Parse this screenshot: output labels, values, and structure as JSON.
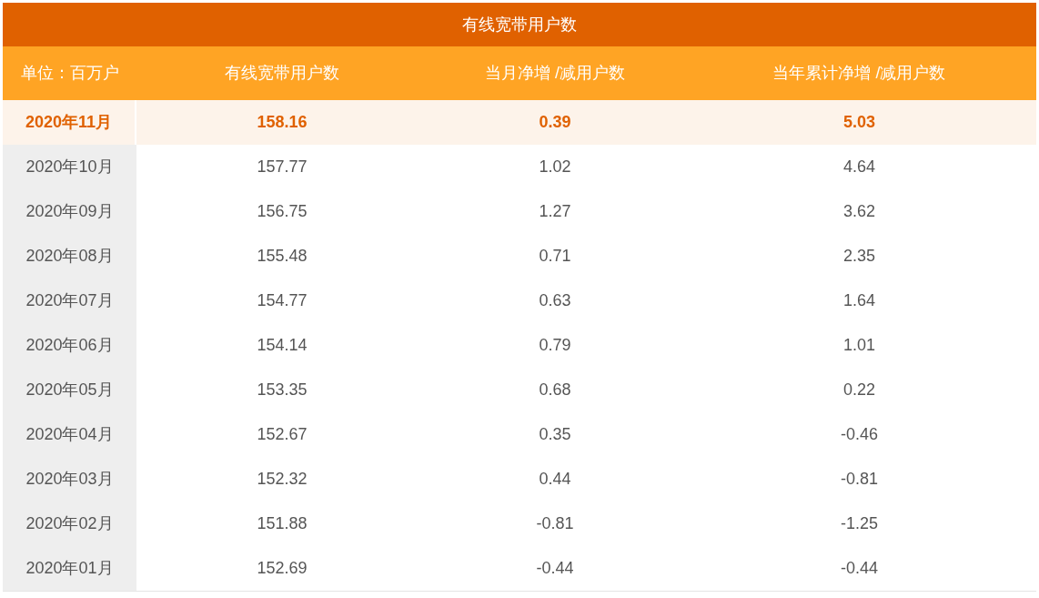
{
  "table": {
    "title": "有线宽带用户数",
    "columns": [
      "单位：百万户",
      "有线宽带用户数",
      "当月净增 /减用户数",
      "当年累计净增 /减用户数"
    ],
    "rows": [
      {
        "selected": true,
        "cells": [
          "2020年11月",
          "158.16",
          "0.39",
          "5.03"
        ]
      },
      {
        "selected": false,
        "cells": [
          "2020年10月",
          "157.77",
          "1.02",
          "4.64"
        ]
      },
      {
        "selected": false,
        "cells": [
          "2020年09月",
          "156.75",
          "1.27",
          "3.62"
        ]
      },
      {
        "selected": false,
        "cells": [
          "2020年08月",
          "155.48",
          "0.71",
          "2.35"
        ]
      },
      {
        "selected": false,
        "cells": [
          "2020年07月",
          "154.77",
          "0.63",
          "1.64"
        ]
      },
      {
        "selected": false,
        "cells": [
          "2020年06月",
          "154.14",
          "0.79",
          "1.01"
        ]
      },
      {
        "selected": false,
        "cells": [
          "2020年05月",
          "153.35",
          "0.68",
          "0.22"
        ]
      },
      {
        "selected": false,
        "cells": [
          "2020年04月",
          "152.67",
          "0.35",
          "-0.46"
        ]
      },
      {
        "selected": false,
        "cells": [
          "2020年03月",
          "152.32",
          "0.44",
          "-0.81"
        ]
      },
      {
        "selected": false,
        "cells": [
          "2020年02月",
          "151.88",
          "-0.81",
          "-1.25"
        ]
      },
      {
        "selected": false,
        "cells": [
          "2020年01月",
          "152.69",
          "-0.44",
          "-0.44"
        ]
      }
    ]
  }
}
